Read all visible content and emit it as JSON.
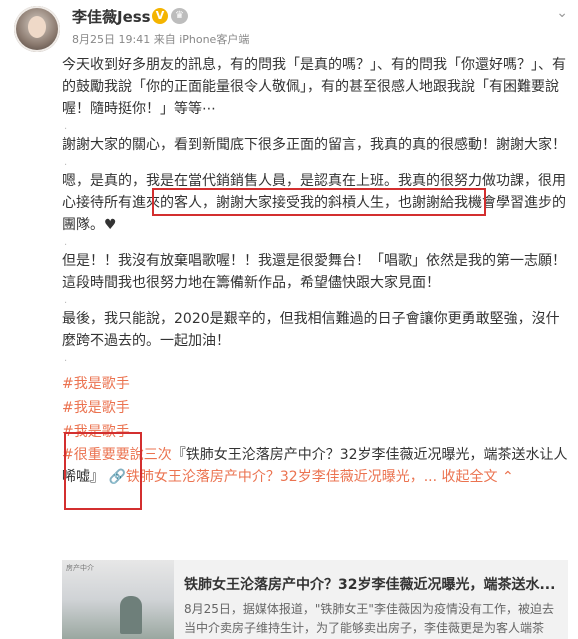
{
  "post": {
    "author": {
      "name": "李佳薇Jess",
      "vip_badge": "V"
    },
    "meta": {
      "date": "8月25日",
      "time": "19:41",
      "source": "来自 iPhone客户端"
    },
    "paragraphs": {
      "p1": "今天收到好多朋友的訊息，有的問我「是真的嗎？」、有的問我「你還好嗎？」、有的鼓勵我說「你的正面能量很令人敬佩」，有的甚至很感人地跟我說「有困難要說喔！隨時挺你！」等等⋯",
      "p2": "謝謝大家的關心，看到新聞底下很多正面的留言，我真的真的很感動！謝謝大家！",
      "p3": "嗯，是真的，我是在當代銷銷售人員，是認真在上班。我真的很努力做功課，很用心接待所有進來的客人，謝謝大家接受我的斜槓人生，也謝謝給我機會學習進步的團隊。♥",
      "p4": "但是！！我沒有放棄唱歌喔！！我還是很愛舞台！「唱歌」依然是我的第一志願！這段時間我也很努力地在籌備新作品，希望儘快跟大家見面！",
      "p5": "最後，我只能說，2020是艱辛的，但我相信難過的日子會讓你更勇敢堅強，沒什麼跨不過去的。一起加油！"
    },
    "dot": ".",
    "hashtags": [
      "#我是歌手",
      "#我是歌手",
      "#我是歌手"
    ],
    "footer": {
      "hashtag": "#很重要要說三次",
      "quote": "『铁肺女王沦落房产中介？32岁李佳薇近况曝光，端茶送水让人唏嘘』",
      "link_icon": "🔗",
      "link_text": "铁肺女王沦落房产中介？32岁李佳薇近况曝光，",
      "collapse": "... 收起全文",
      "collapse_arrow": "⌃"
    },
    "card": {
      "title": "铁肺女王沦落房产中介？32岁李佳薇近况曝光，端茶送水...",
      "desc_line1": "8月25日，据媒体报道，\"铁肺女王\"李佳薇因为疫情没有工作，被迫去",
      "desc_line2": "当中介卖房子维持生计，为了能够卖出房子，李佳薇更是为客人端茶",
      "thumb_text": "房产中介"
    }
  },
  "icons": {
    "dropdown": "chevron-down-icon",
    "crown": "crown-icon",
    "link": "link-icon"
  },
  "colors": {
    "hashtag": "#eb7350",
    "highlight_box": "#d32f2f",
    "meta": "#888888"
  }
}
